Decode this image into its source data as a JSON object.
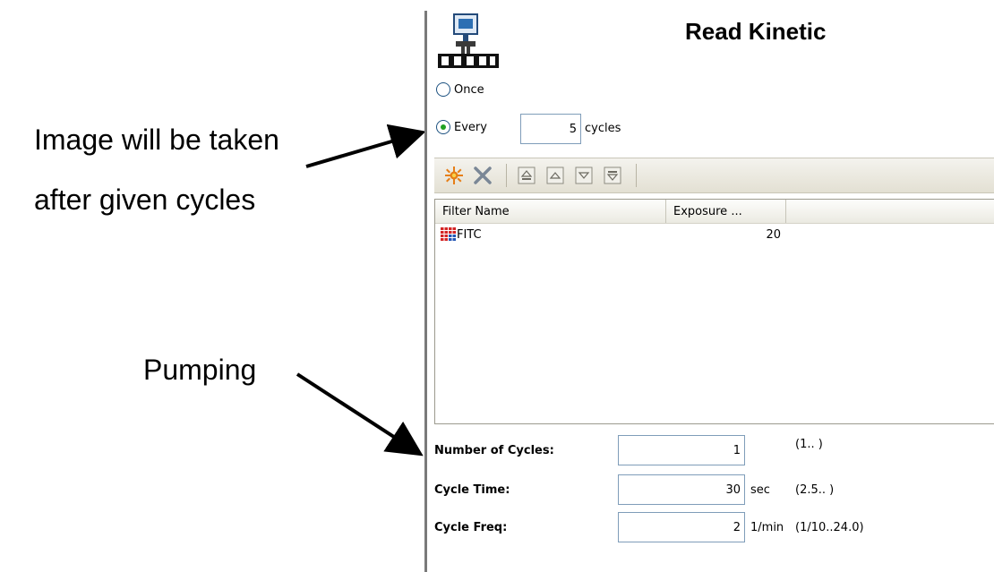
{
  "annotations": {
    "image_line1": "Image will be taken",
    "image_line2": "after given cycles",
    "pumping": "Pumping"
  },
  "panel": {
    "title": "Read Kinetic",
    "app_icon": "robot-plate-reader-icon",
    "read_mode": {
      "once_label": "Once",
      "every_label": "Every",
      "every_value": "5",
      "cycles_label": "cycles",
      "selected": "every"
    },
    "toolbar": {
      "icons": [
        "add-filter-icon",
        "delete-icon",
        "move-top-icon",
        "move-up-icon",
        "move-down-icon",
        "move-bottom-icon"
      ]
    },
    "filter_table": {
      "columns": [
        "Filter Name",
        "Exposure ..."
      ],
      "rows": [
        {
          "icon": "filter-grid-icon",
          "name": "FITC",
          "exposure": "20"
        }
      ]
    },
    "cycle_settings": [
      {
        "label": "Number of Cycles:",
        "value": "1",
        "unit": "",
        "range": "(1..  )"
      },
      {
        "label": "Cycle Time:",
        "value": "30",
        "unit": "sec",
        "range": "(2.5..  )"
      },
      {
        "label": "Cycle Freq:",
        "value": "2",
        "unit": "1/min",
        "range": "(1/10..24.0)"
      }
    ]
  },
  "colors": {
    "accent_radio": "#21a121",
    "input_border": "#7f9db9",
    "toolbar_bg": "#e3e0d3"
  }
}
